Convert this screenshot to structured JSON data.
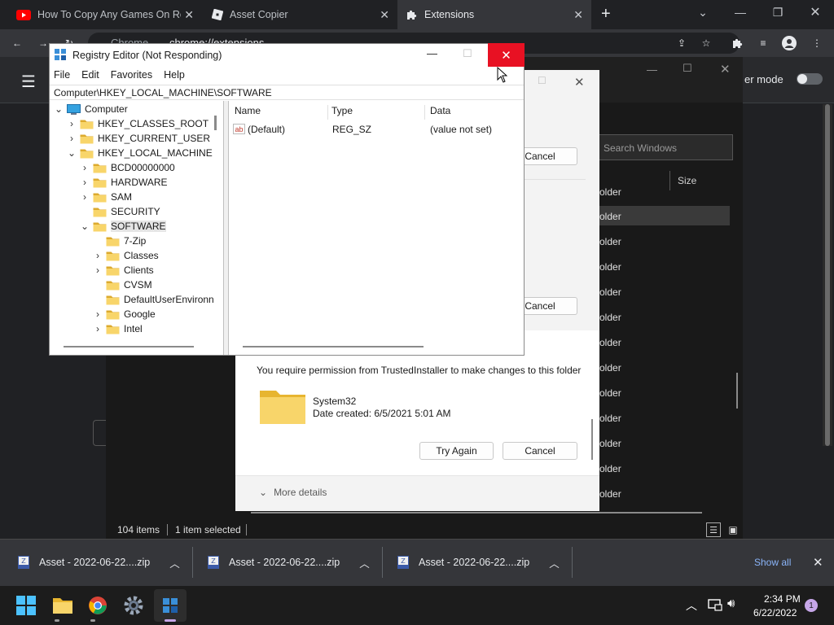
{
  "browser": {
    "tabs": [
      {
        "label": "How To Copy Any Games On Rob",
        "icon": "youtube-icon"
      },
      {
        "label": "Asset Copier",
        "icon": "roblox-icon"
      },
      {
        "label": "Extensions",
        "icon": "puzzle-icon"
      }
    ],
    "address": "chrome://extensions",
    "address_prefix": "Chrome",
    "dev_mode_label": "er mode"
  },
  "explorer": {
    "search_placeholder": "Search Windows",
    "size_header": "Size",
    "rows": [
      "older",
      "older",
      "older",
      "older",
      "older",
      "older",
      "older",
      "older",
      "older",
      "older",
      "older",
      "older",
      "older"
    ],
    "status_items": "104 items",
    "status_selected": "1 item selected"
  },
  "permission_dialog": {
    "cancel_label": "Cancel",
    "message": "You require permission from TrustedInstaller to make changes to this folder",
    "folder_name": "System32",
    "date_created": "Date created: 6/5/2021 5:01 AM",
    "try_again_label": "Try Again",
    "more_details": "More details"
  },
  "regedit": {
    "title": "Registry Editor (Not Responding)",
    "menu": [
      "File",
      "Edit",
      "Favorites",
      "Help"
    ],
    "address": "Computer\\HKEY_LOCAL_MACHINE\\SOFTWARE",
    "tree": [
      {
        "label": "Computer",
        "level": 0,
        "state": "open"
      },
      {
        "label": "HKEY_CLASSES_ROOT",
        "level": 1,
        "state": "closed"
      },
      {
        "label": "HKEY_CURRENT_USER",
        "level": 1,
        "state": "closed"
      },
      {
        "label": "HKEY_LOCAL_MACHINE",
        "level": 1,
        "state": "open"
      },
      {
        "label": "BCD00000000",
        "level": 2,
        "state": "closed"
      },
      {
        "label": "HARDWARE",
        "level": 2,
        "state": "closed"
      },
      {
        "label": "SAM",
        "level": 2,
        "state": "closed"
      },
      {
        "label": "SECURITY",
        "level": 2,
        "state": "none"
      },
      {
        "label": "SOFTWARE",
        "level": 2,
        "state": "open",
        "selected": true
      },
      {
        "label": "7-Zip",
        "level": 3,
        "state": "none"
      },
      {
        "label": "Classes",
        "level": 3,
        "state": "closed"
      },
      {
        "label": "Clients",
        "level": 3,
        "state": "closed"
      },
      {
        "label": "CVSM",
        "level": 3,
        "state": "none"
      },
      {
        "label": "DefaultUserEnvironn",
        "level": 3,
        "state": "none"
      },
      {
        "label": "Google",
        "level": 3,
        "state": "closed"
      },
      {
        "label": "Intel",
        "level": 3,
        "state": "closed"
      }
    ],
    "columns": [
      "Name",
      "Type",
      "Data"
    ],
    "values": [
      {
        "name": "(Default)",
        "type": "REG_SZ",
        "data": "(value not set)"
      }
    ]
  },
  "downloads": {
    "items": [
      "Asset - 2022-06-22....zip",
      "Asset - 2022-06-22....zip",
      "Asset - 2022-06-22....zip"
    ],
    "show_all": "Show all"
  },
  "taskbar": {
    "time": "2:34 PM",
    "date": "6/22/2022",
    "notification_count": "1"
  },
  "colors": {
    "close_red": "#e81123",
    "folder_yellow": "#f4c542",
    "link_blue": "#8ab4f8"
  }
}
